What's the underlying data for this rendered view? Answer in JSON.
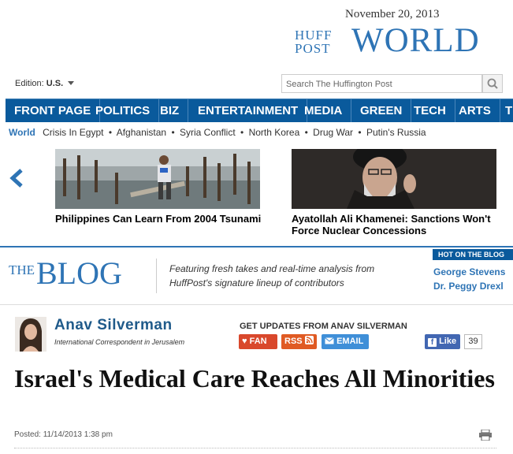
{
  "header": {
    "date": "November 20, 2013",
    "brand_line1": "HUFF",
    "brand_line2": "POST",
    "section": "WORLD",
    "edition_label": "Edition:",
    "edition_value": "U.S.",
    "search_placeholder": "Search The Huffington Post"
  },
  "nav": {
    "items": [
      "FRONT PAGE",
      "POLITICS",
      "BIZ",
      "ENTERTAINMENT",
      "MEDIA",
      "GREEN",
      "TECH",
      "ARTS",
      "TI"
    ]
  },
  "subnav": {
    "current": "World",
    "links": [
      "Crisis In Egypt",
      "Afghanistan",
      "Syria Conflict",
      "North Korea",
      "Drug War",
      "Putin's Russia"
    ],
    "separator": "•"
  },
  "carousel": {
    "items": [
      {
        "caption": "Philippines Can Learn From 2004 Tsunami"
      },
      {
        "caption": "Ayatollah Ali Khamenei: Sanctions Won't Force Nuclear Concessions"
      }
    ]
  },
  "blog": {
    "the": "THE",
    "blog": "BLOG",
    "tagline": "Featuring fresh takes and real-time analysis from HuffPost's signature lineup of contributors",
    "hot_label": "HOT ON THE BLOG",
    "hot_items": [
      "George Stevens",
      "Dr. Peggy Drexl"
    ]
  },
  "author": {
    "name": "Anav Silverman",
    "title": "International Correspondent in Jerusalem",
    "updates_label": "GET UPDATES FROM ANAV SILVERMAN",
    "fan_label": "FAN",
    "rss_label": "RSS",
    "email_label": "EMAIL",
    "like_label": "Like",
    "like_count": "39"
  },
  "article": {
    "headline": "Israel's Medical Care Reaches All Minorities",
    "posted": "Posted: 11/14/2013 1:38 pm"
  },
  "colors": {
    "brand_blue": "#2e74b5",
    "nav_blue": "#0a5a9c",
    "fan_red": "#d9482c",
    "rss_orange": "#e05a23",
    "email_blue": "#3f8fd8",
    "facebook_blue": "#4267b2"
  },
  "icons": [
    "search-icon",
    "caret-down-icon",
    "chevron-left-icon",
    "heart-icon",
    "rss-icon",
    "email-icon",
    "facebook-icon",
    "print-icon"
  ]
}
